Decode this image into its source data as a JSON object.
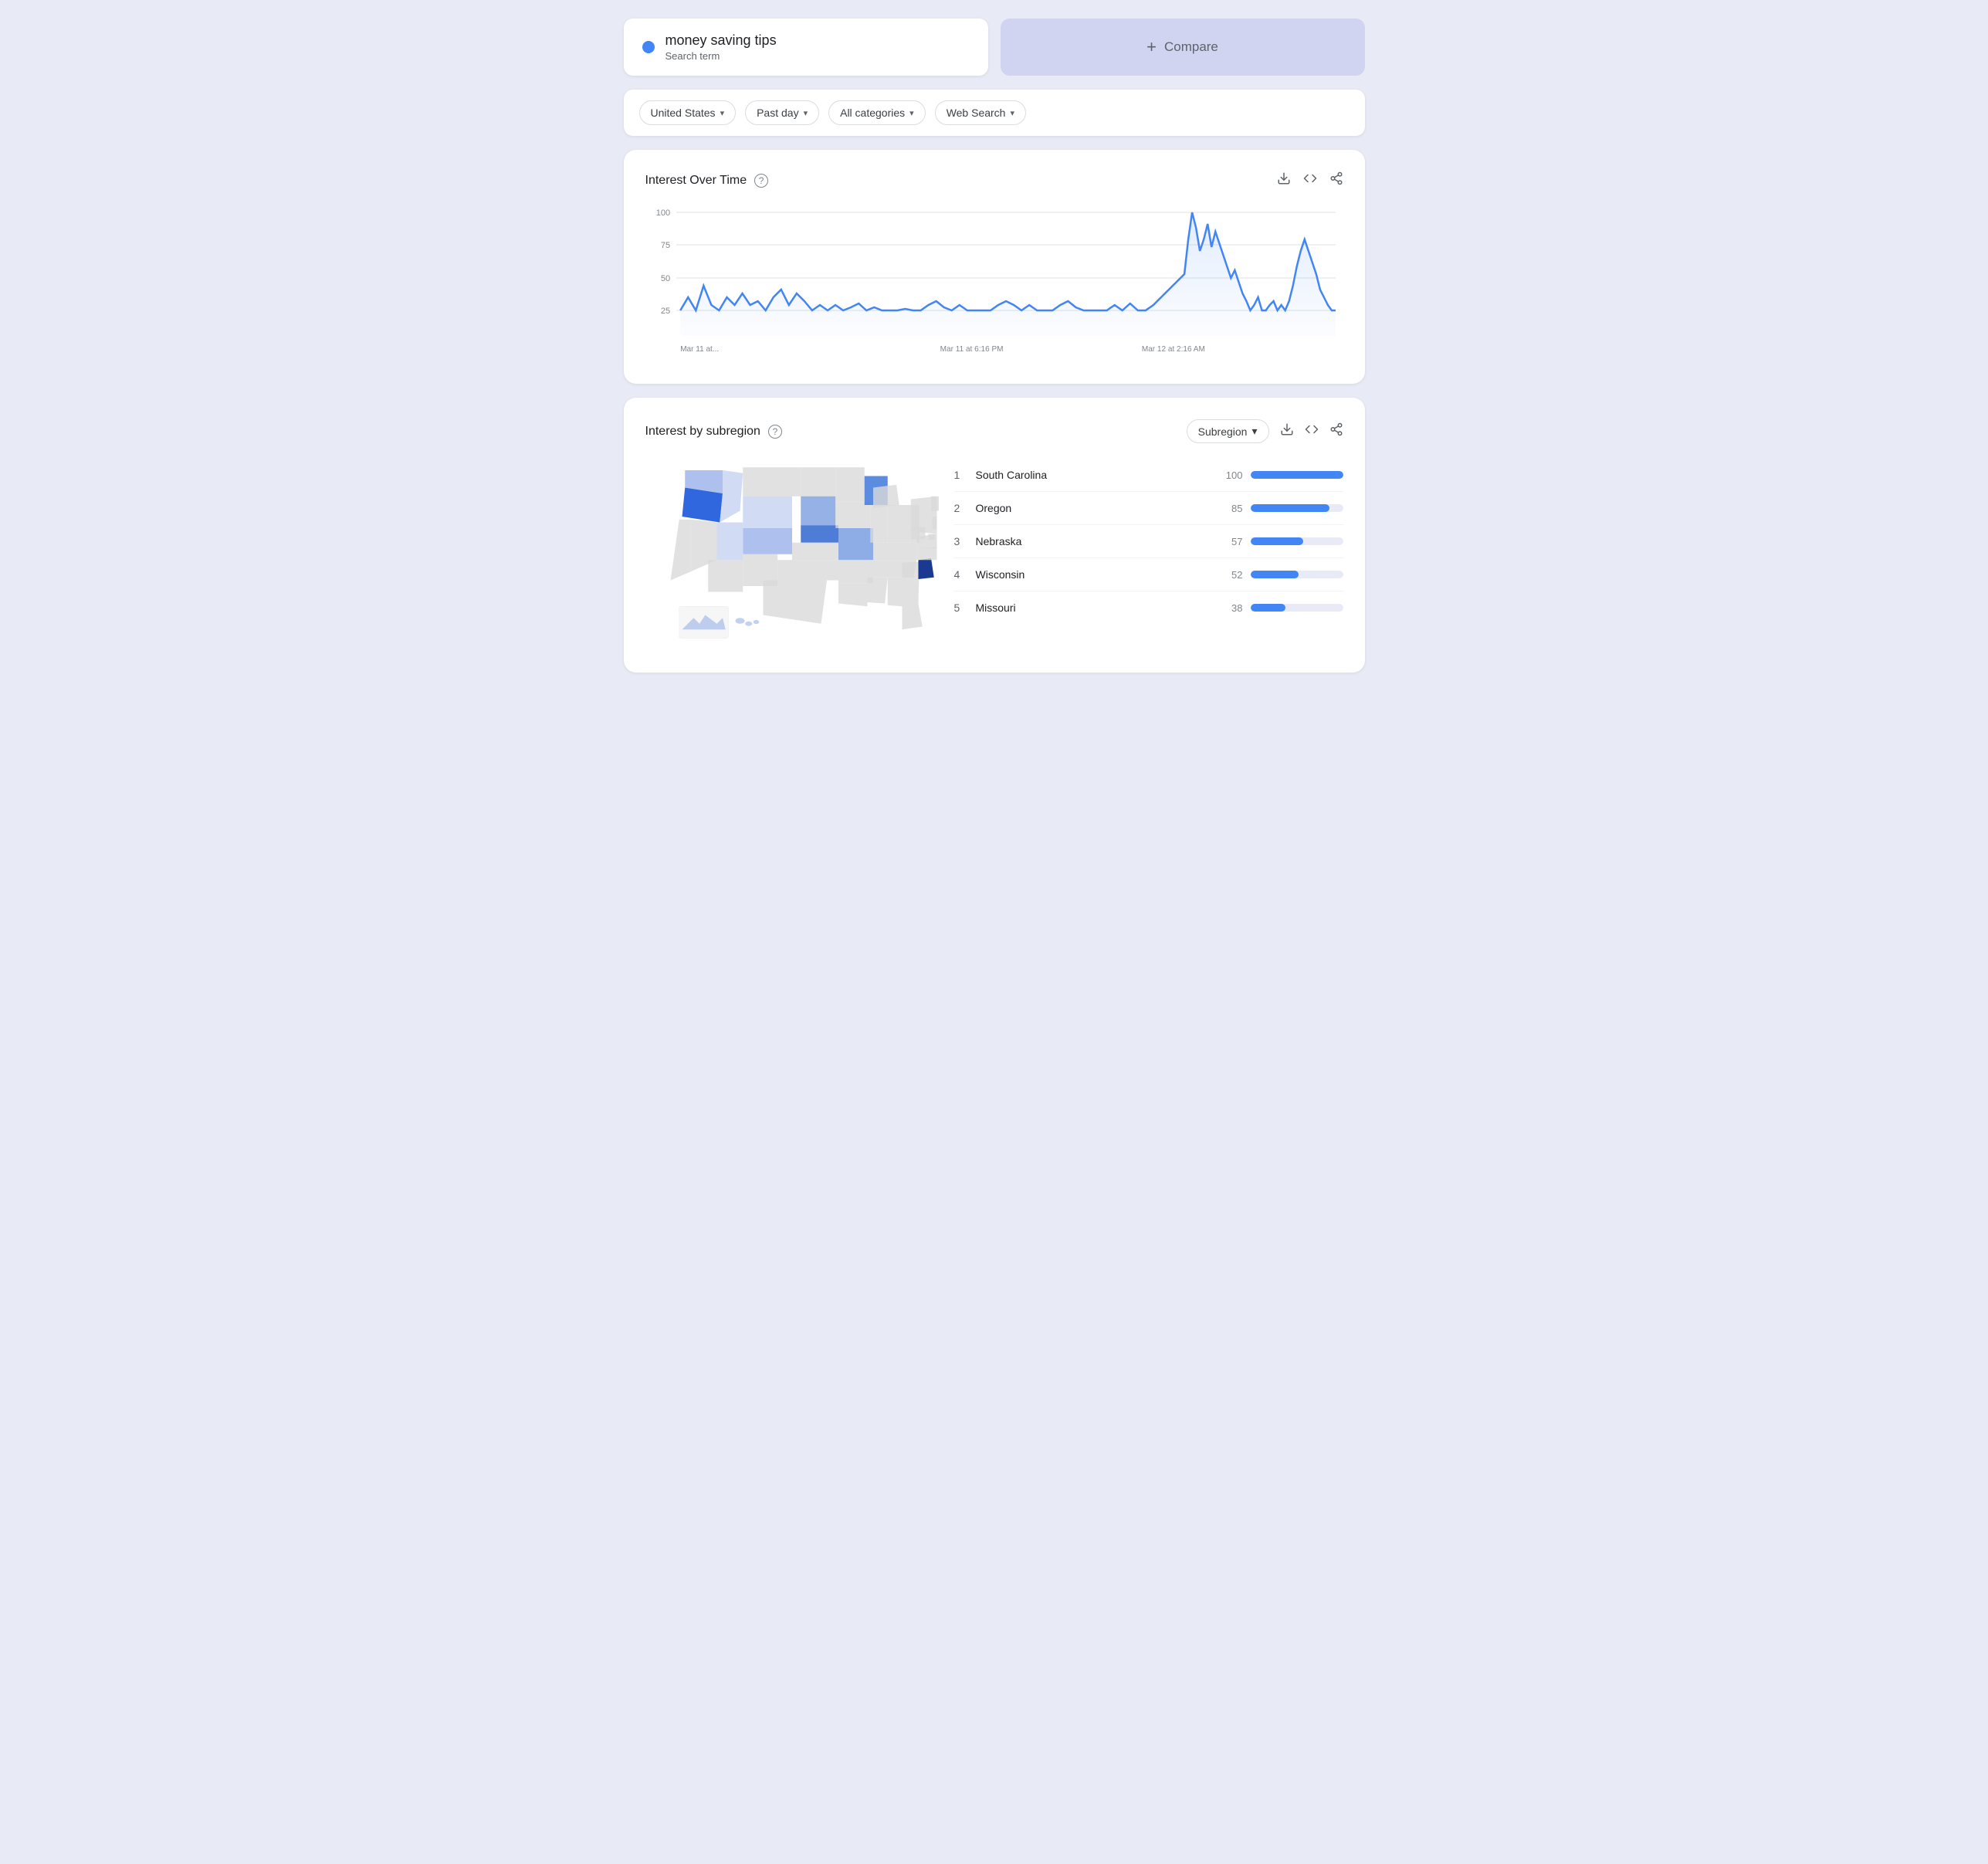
{
  "search": {
    "term": "money saving tips",
    "sublabel": "Search term",
    "dot_color": "#4285F4"
  },
  "compare": {
    "label": "Compare",
    "plus": "+"
  },
  "filters": [
    {
      "label": "United States",
      "id": "region"
    },
    {
      "label": "Past day",
      "id": "time"
    },
    {
      "label": "All categories",
      "id": "category"
    },
    {
      "label": "Web Search",
      "id": "type"
    }
  ],
  "interest_over_time": {
    "title": "Interest Over Time",
    "y_labels": [
      "100",
      "75",
      "50",
      "25"
    ],
    "x_labels": [
      "Mar 11 at...",
      "Mar 11 at 6:16 PM",
      "Mar 12 at 2:16 AM"
    ],
    "help_text": "?",
    "actions": {
      "download": "⬇",
      "embed": "<>",
      "share": "share"
    }
  },
  "interest_by_subregion": {
    "title": "Interest by subregion",
    "dropdown_label": "Subregion",
    "help_text": "?",
    "rankings": [
      {
        "rank": 1,
        "name": "South Carolina",
        "value": 100,
        "pct": 100
      },
      {
        "rank": 2,
        "name": "Oregon",
        "value": 85,
        "pct": 85
      },
      {
        "rank": 3,
        "name": "Nebraska",
        "value": 57,
        "pct": 57
      },
      {
        "rank": 4,
        "name": "Wisconsin",
        "value": 52,
        "pct": 52
      },
      {
        "rank": 5,
        "name": "Missouri",
        "value": 38,
        "pct": 38
      }
    ]
  },
  "chart": {
    "accent_color": "#4285F4",
    "y_max": 100,
    "gridlines": [
      100,
      75,
      50,
      25
    ]
  }
}
